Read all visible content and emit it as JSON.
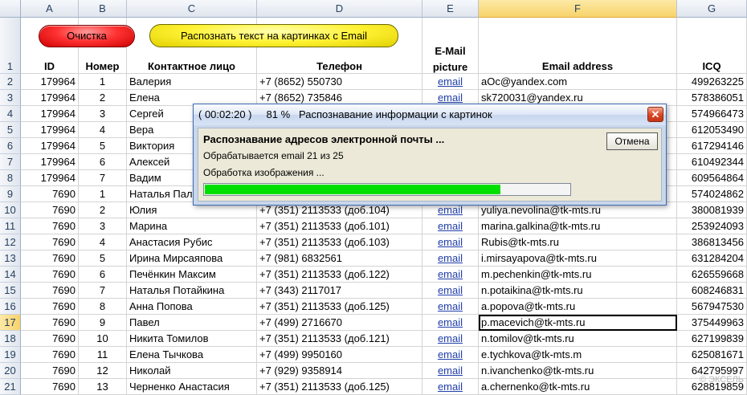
{
  "columns": [
    "A",
    "B",
    "C",
    "D",
    "E",
    "F",
    "G"
  ],
  "selected_column": "F",
  "buttons": {
    "clear": "Очистка",
    "recognize": "Распознать текст на картинках с Email"
  },
  "header_row": {
    "row_num": "1",
    "id": "ID",
    "number": "Номер",
    "contact": "Контактное лицо",
    "phone": "Телефон",
    "email_picture_line1": "E-Mail",
    "email_picture_line2": "picture",
    "email_address": "Email address",
    "icq": "ICQ"
  },
  "rows": [
    {
      "n": "2",
      "id": "179964",
      "num": "1",
      "name": "Валерия",
      "phone": "+7 (8652) 550730",
      "pic": "email",
      "email": "aOc@yandex.com",
      "icq": "499263225"
    },
    {
      "n": "3",
      "id": "179964",
      "num": "2",
      "name": "Елена",
      "phone": "+7 (8652) 735846",
      "pic": "email",
      "email": "sk720031@yandex.ru",
      "icq": "578386051"
    },
    {
      "n": "4",
      "id": "179964",
      "num": "3",
      "name": "Сергей",
      "phone": "",
      "pic": "",
      "email": "",
      "icq": "574966473"
    },
    {
      "n": "5",
      "id": "179964",
      "num": "4",
      "name": "Вера",
      "phone": "",
      "pic": "",
      "email": "",
      "icq": "612053490"
    },
    {
      "n": "6",
      "id": "179964",
      "num": "5",
      "name": "Виктория",
      "phone": "",
      "pic": "",
      "email": "",
      "icq": "617294146"
    },
    {
      "n": "7",
      "id": "179964",
      "num": "6",
      "name": "Алексей",
      "phone": "",
      "pic": "",
      "email": "",
      "icq": "610492344"
    },
    {
      "n": "8",
      "id": "179964",
      "num": "7",
      "name": "Вадим",
      "phone": "",
      "pic": "",
      "email": "",
      "icq": "609564864"
    },
    {
      "n": "9",
      "id": "7690",
      "num": "1",
      "name": "Наталья Пал",
      "phone": "",
      "pic": "",
      "email": "",
      "icq": "574024862"
    },
    {
      "n": "10",
      "id": "7690",
      "num": "2",
      "name": "Юлия",
      "phone": "+7 (351) 2113533 (доб.104)",
      "pic": "email",
      "email": "yuliya.nevolina@tk-mts.ru",
      "icq": "380081939"
    },
    {
      "n": "11",
      "id": "7690",
      "num": "3",
      "name": "Марина",
      "phone": "+7 (351) 2113533 (доб.101)",
      "pic": "email",
      "email": "marina.galkina@tk-mts.ru",
      "icq": "253924093"
    },
    {
      "n": "12",
      "id": "7690",
      "num": "4",
      "name": "Анастасия Рубис",
      "phone": "+7 (351) 2113533 (доб.103)",
      "pic": "email",
      "email": "Rubis@tk-mts.ru",
      "icq": "386813456"
    },
    {
      "n": "13",
      "id": "7690",
      "num": "5",
      "name": "Ирина Мирсаяпова",
      "phone": "+7 (981) 6832561",
      "pic": "email",
      "email": "i.mirsayapova@tk-mts.ru",
      "icq": "631284204"
    },
    {
      "n": "14",
      "id": "7690",
      "num": "6",
      "name": "Печёнкин Максим",
      "phone": "+7 (351) 2113533 (доб.122)",
      "pic": "email",
      "email": "m.pechenkin@tk-mts.ru",
      "icq": "626559668"
    },
    {
      "n": "15",
      "id": "7690",
      "num": "7",
      "name": "Наталья Потайкина",
      "phone": "+7 (343) 2117017",
      "pic": "email",
      "email": "n.potaikina@tk-mts.ru",
      "icq": "608246831"
    },
    {
      "n": "16",
      "id": "7690",
      "num": "8",
      "name": "Анна Попова",
      "phone": "+7 (351) 2113533 (доб.125)",
      "pic": "email",
      "email": "a.popova@tk-mts.ru",
      "icq": "567947530"
    },
    {
      "n": "17",
      "id": "7690",
      "num": "9",
      "name": "Павел",
      "phone": "+7 (499) 2716670",
      "pic": "email",
      "email": "p.macevich@tk-mts.ru",
      "icq": "375449963"
    },
    {
      "n": "18",
      "id": "7690",
      "num": "10",
      "name": "Никита Томилов",
      "phone": "+7 (351) 2113533 (доб.121)",
      "pic": "email",
      "email": "n.tomilov@tk-mts.ru",
      "icq": "627199839"
    },
    {
      "n": "19",
      "id": "7690",
      "num": "11",
      "name": "Елена Тычкова",
      "phone": "+7 (499) 9950160",
      "pic": "email",
      "email": "e.tychkova@tk-mts.m",
      "icq": "625081671"
    },
    {
      "n": "20",
      "id": "7690",
      "num": "12",
      "name": "Николай",
      "phone": "+7 (929) 9358914",
      "pic": "email",
      "email": "n.ivanchenko@tk-mts.ru",
      "icq": "642795997"
    },
    {
      "n": "21",
      "id": "7690",
      "num": "13",
      "name": "Черненко Анастасия",
      "phone": "+7 (351) 2113533 (доб.125)",
      "pic": "email",
      "email": "a.chernenko@tk-mts.ru",
      "icq": "628819859"
    }
  ],
  "selected_row": "17",
  "dialog": {
    "title": "( 00:02:20 )     81 %   Распознавание информации с картинок",
    "close": "✕",
    "heading": "Распознавание адресов электронной почты ...",
    "status": "Обрабатывается email 21 из 25",
    "substatus": "Обработка изображения ...",
    "cancel": "Отмена",
    "progress": 0.81
  },
  "watermark": "© ЭКСЕЛЬ"
}
